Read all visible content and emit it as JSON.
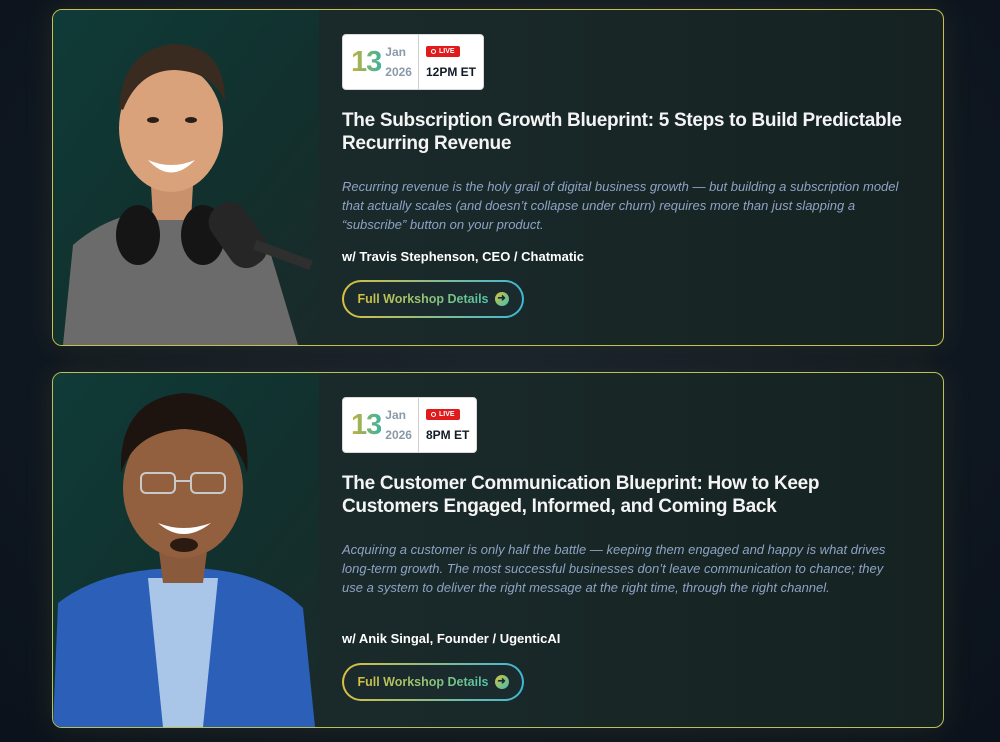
{
  "workshops": [
    {
      "day": "13",
      "month": "Jan",
      "year": "2026",
      "live_label": "LIVE",
      "time": "12PM ET",
      "title": "The Subscription Growth Blueprint: 5 Steps to Build Predictable Recurring Revenue",
      "description": "Recurring revenue is the holy grail of digital business growth — but building a subscription model that actually scales (and doesn’t collapse under churn) requires more than just slapping a “subscribe” button on your product.",
      "speaker": "w/ Travis Stephenson, CEO / Chatmatic",
      "button_label": "Full Workshop Details",
      "photo_icon": "speaker-photo"
    },
    {
      "day": "13",
      "month": "Jan",
      "year": "2026",
      "live_label": "LIVE",
      "time": "8PM ET",
      "title": "The Customer Communication Blueprint: How to Keep Customers Engaged, Informed, and Coming Back",
      "description": "Acquiring a customer is only half the battle — keeping them engaged and happy is what drives long-term growth. The most successful businesses don’t leave communication to chance; they use a system to deliver the right message at the right time, through the right channel.",
      "speaker": "w/ Anik Singal,  Founder / UgenticAI",
      "button_label": "Full Workshop Details",
      "photo_icon": "speaker-photo"
    }
  ],
  "colors": {
    "background": "#0f1722",
    "card": "#1b2a2c",
    "accent_gold": "#d7c23f",
    "accent_teal": "#3fb8c8",
    "live_red": "#e01b1b",
    "description": "#8ea3c4"
  }
}
